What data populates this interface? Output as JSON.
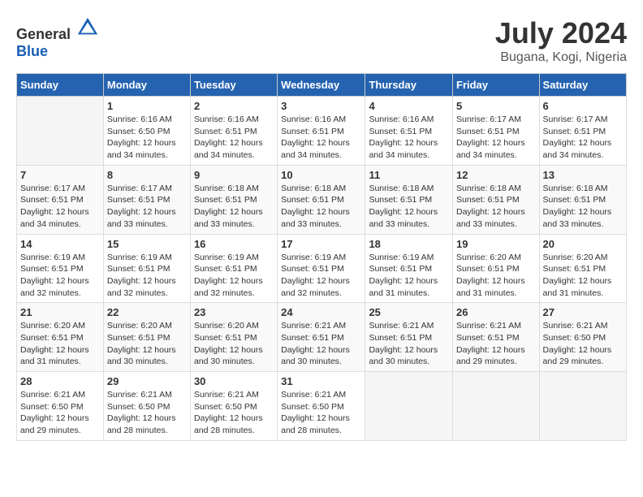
{
  "header": {
    "logo_general": "General",
    "logo_blue": "Blue",
    "month": "July 2024",
    "location": "Bugana, Kogi, Nigeria"
  },
  "days_of_week": [
    "Sunday",
    "Monday",
    "Tuesday",
    "Wednesday",
    "Thursday",
    "Friday",
    "Saturday"
  ],
  "weeks": [
    [
      {
        "day": "",
        "sunrise": "",
        "sunset": "",
        "daylight": ""
      },
      {
        "day": "1",
        "sunrise": "6:16 AM",
        "sunset": "6:50 PM",
        "daylight": "12 hours and 34 minutes."
      },
      {
        "day": "2",
        "sunrise": "6:16 AM",
        "sunset": "6:51 PM",
        "daylight": "12 hours and 34 minutes."
      },
      {
        "day": "3",
        "sunrise": "6:16 AM",
        "sunset": "6:51 PM",
        "daylight": "12 hours and 34 minutes."
      },
      {
        "day": "4",
        "sunrise": "6:16 AM",
        "sunset": "6:51 PM",
        "daylight": "12 hours and 34 minutes."
      },
      {
        "day": "5",
        "sunrise": "6:17 AM",
        "sunset": "6:51 PM",
        "daylight": "12 hours and 34 minutes."
      },
      {
        "day": "6",
        "sunrise": "6:17 AM",
        "sunset": "6:51 PM",
        "daylight": "12 hours and 34 minutes."
      }
    ],
    [
      {
        "day": "7",
        "sunrise": "6:17 AM",
        "sunset": "6:51 PM",
        "daylight": "12 hours and 34 minutes."
      },
      {
        "day": "8",
        "sunrise": "6:17 AM",
        "sunset": "6:51 PM",
        "daylight": "12 hours and 33 minutes."
      },
      {
        "day": "9",
        "sunrise": "6:18 AM",
        "sunset": "6:51 PM",
        "daylight": "12 hours and 33 minutes."
      },
      {
        "day": "10",
        "sunrise": "6:18 AM",
        "sunset": "6:51 PM",
        "daylight": "12 hours and 33 minutes."
      },
      {
        "day": "11",
        "sunrise": "6:18 AM",
        "sunset": "6:51 PM",
        "daylight": "12 hours and 33 minutes."
      },
      {
        "day": "12",
        "sunrise": "6:18 AM",
        "sunset": "6:51 PM",
        "daylight": "12 hours and 33 minutes."
      },
      {
        "day": "13",
        "sunrise": "6:18 AM",
        "sunset": "6:51 PM",
        "daylight": "12 hours and 33 minutes."
      }
    ],
    [
      {
        "day": "14",
        "sunrise": "6:19 AM",
        "sunset": "6:51 PM",
        "daylight": "12 hours and 32 minutes."
      },
      {
        "day": "15",
        "sunrise": "6:19 AM",
        "sunset": "6:51 PM",
        "daylight": "12 hours and 32 minutes."
      },
      {
        "day": "16",
        "sunrise": "6:19 AM",
        "sunset": "6:51 PM",
        "daylight": "12 hours and 32 minutes."
      },
      {
        "day": "17",
        "sunrise": "6:19 AM",
        "sunset": "6:51 PM",
        "daylight": "12 hours and 32 minutes."
      },
      {
        "day": "18",
        "sunrise": "6:19 AM",
        "sunset": "6:51 PM",
        "daylight": "12 hours and 31 minutes."
      },
      {
        "day": "19",
        "sunrise": "6:20 AM",
        "sunset": "6:51 PM",
        "daylight": "12 hours and 31 minutes."
      },
      {
        "day": "20",
        "sunrise": "6:20 AM",
        "sunset": "6:51 PM",
        "daylight": "12 hours and 31 minutes."
      }
    ],
    [
      {
        "day": "21",
        "sunrise": "6:20 AM",
        "sunset": "6:51 PM",
        "daylight": "12 hours and 31 minutes."
      },
      {
        "day": "22",
        "sunrise": "6:20 AM",
        "sunset": "6:51 PM",
        "daylight": "12 hours and 30 minutes."
      },
      {
        "day": "23",
        "sunrise": "6:20 AM",
        "sunset": "6:51 PM",
        "daylight": "12 hours and 30 minutes."
      },
      {
        "day": "24",
        "sunrise": "6:21 AM",
        "sunset": "6:51 PM",
        "daylight": "12 hours and 30 minutes."
      },
      {
        "day": "25",
        "sunrise": "6:21 AM",
        "sunset": "6:51 PM",
        "daylight": "12 hours and 30 minutes."
      },
      {
        "day": "26",
        "sunrise": "6:21 AM",
        "sunset": "6:51 PM",
        "daylight": "12 hours and 29 minutes."
      },
      {
        "day": "27",
        "sunrise": "6:21 AM",
        "sunset": "6:50 PM",
        "daylight": "12 hours and 29 minutes."
      }
    ],
    [
      {
        "day": "28",
        "sunrise": "6:21 AM",
        "sunset": "6:50 PM",
        "daylight": "12 hours and 29 minutes."
      },
      {
        "day": "29",
        "sunrise": "6:21 AM",
        "sunset": "6:50 PM",
        "daylight": "12 hours and 28 minutes."
      },
      {
        "day": "30",
        "sunrise": "6:21 AM",
        "sunset": "6:50 PM",
        "daylight": "12 hours and 28 minutes."
      },
      {
        "day": "31",
        "sunrise": "6:21 AM",
        "sunset": "6:50 PM",
        "daylight": "12 hours and 28 minutes."
      },
      {
        "day": "",
        "sunrise": "",
        "sunset": "",
        "daylight": ""
      },
      {
        "day": "",
        "sunrise": "",
        "sunset": "",
        "daylight": ""
      },
      {
        "day": "",
        "sunrise": "",
        "sunset": "",
        "daylight": ""
      }
    ]
  ]
}
